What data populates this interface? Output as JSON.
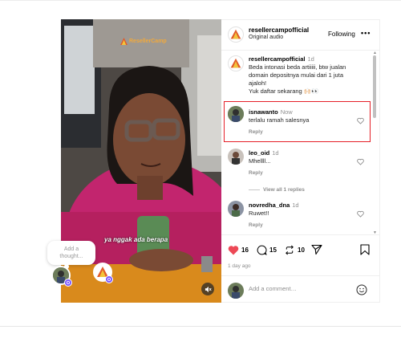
{
  "post": {
    "brand_text": "ResellerCamp",
    "overlay_caption": "ya nggak ada berapa",
    "thought_placeholder_line1": "Add a",
    "thought_placeholder_line2": "thought..."
  },
  "header": {
    "username": "resellercampofficial",
    "audio": "Original audio",
    "following_label": "Following",
    "more_label": "•••"
  },
  "caption": {
    "username": "resellercampofficial",
    "time": "1d",
    "text_line1": "Beda intonasi beda artiiiii, btw jualan",
    "text_line2": "domain depositnya mulai dari 1 juta",
    "text_line3": "ajaloh!",
    "text_line4": "Yuk daftar sekarang 🙌🏻👀"
  },
  "comments": [
    {
      "username": "isnawanto",
      "time": "Now",
      "text": "terlalu ramah salesnya",
      "reply": "Reply"
    },
    {
      "username": "leo_oid",
      "time": "1d",
      "text": "Mhellll...",
      "reply": "Reply",
      "view_replies": "View all 1 replies"
    },
    {
      "username": "novredha_dna",
      "time": "1d",
      "text": "Ruwet!!",
      "reply": "Reply"
    }
  ],
  "actions": {
    "likes": "16",
    "comments": "15",
    "reposts": "10",
    "ago": "1 day ago"
  },
  "composer": {
    "placeholder": "Add a comment…"
  },
  "colors": {
    "highlight": "#e52028",
    "like": "#ed4956",
    "badge": "#7b58ff"
  }
}
